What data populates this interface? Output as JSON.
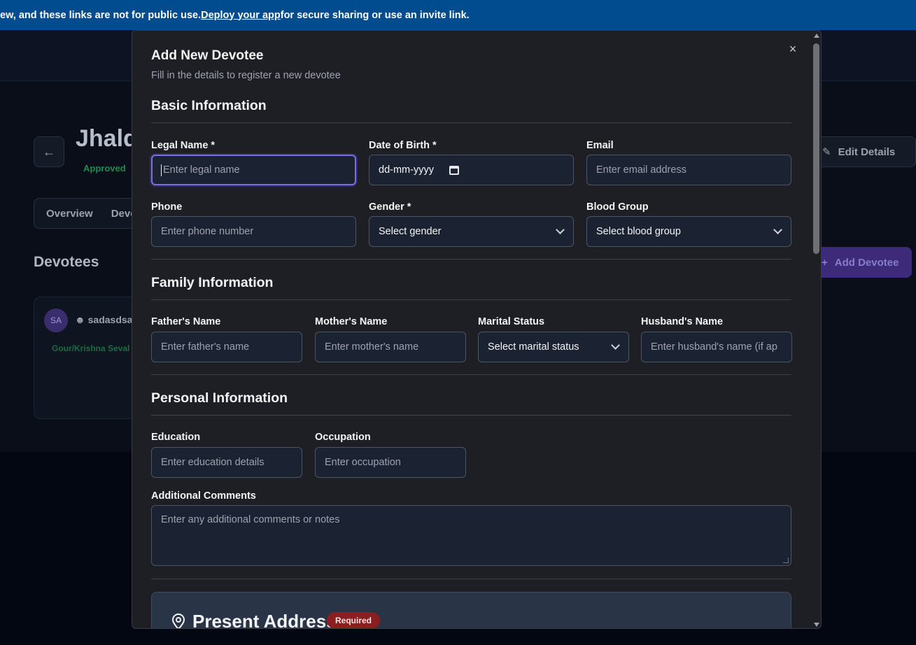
{
  "banner": {
    "text_before": "ew, and these links are not for public use. ",
    "link": "Deploy your app",
    "text_after": " for secure sharing or use an invite link."
  },
  "background": {
    "title": "Jhald",
    "status": "Approved",
    "edit_button": "Edit Details",
    "tabs": [
      "Overview",
      "Devo"
    ],
    "section_title": "Devotees",
    "add_button": "Add Devotee",
    "devotee_card": {
      "initials": "SA",
      "name": "sadasdsac",
      "seva": "Gour/Krishna Seval"
    }
  },
  "modal": {
    "title": "Add New Devotee",
    "subtitle": "Fill in the details to register a new devotee",
    "close_symbol": "×",
    "sections": {
      "basic": "Basic Information",
      "family": "Family Information",
      "personal": "Personal Information"
    },
    "fields": {
      "legal_name": {
        "label": "Legal Name *",
        "placeholder": "Enter legal name"
      },
      "dob": {
        "label": "Date of Birth *",
        "value": "dd-mm-yyyy"
      },
      "email": {
        "label": "Email",
        "placeholder": "Enter email address"
      },
      "phone": {
        "label": "Phone",
        "placeholder": "Enter phone number"
      },
      "gender": {
        "label": "Gender *",
        "value": "Select gender"
      },
      "blood_group": {
        "label": "Blood Group",
        "value": "Select blood group"
      },
      "father": {
        "label": "Father's Name",
        "placeholder": "Enter father's name"
      },
      "mother": {
        "label": "Mother's Name",
        "placeholder": "Enter mother's name"
      },
      "marital": {
        "label": "Marital Status",
        "value": "Select marital status"
      },
      "husband": {
        "label": "Husband's Name",
        "placeholder": "Enter husband's name (if ap"
      },
      "education": {
        "label": "Education",
        "placeholder": "Enter education details"
      },
      "occupation": {
        "label": "Occupation",
        "placeholder": "Enter occupation"
      },
      "comments": {
        "label": "Additional Comments",
        "placeholder": "Enter any additional comments or notes"
      }
    },
    "address": {
      "title": "Present Address",
      "badge": "Required"
    }
  },
  "colors": {
    "focus_ring": "#7c6fe0",
    "banner": "#004c8f",
    "required_badge": "#8b1f1f"
  }
}
